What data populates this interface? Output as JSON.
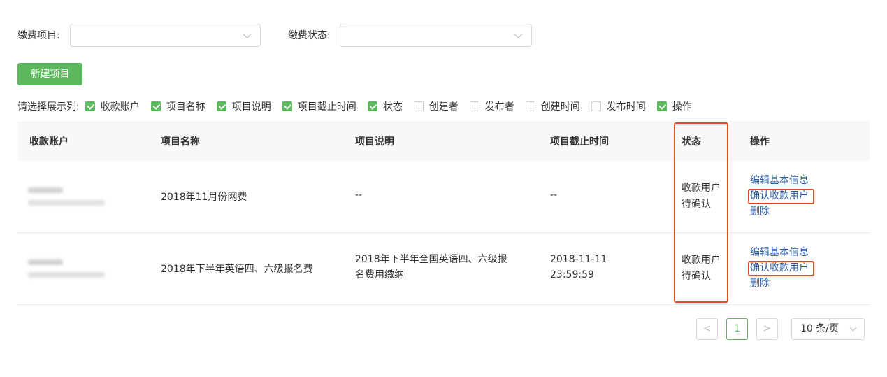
{
  "filters": {
    "item_label": "缴费项目:",
    "item_value": "",
    "status_label": "缴费状态:",
    "status_value": ""
  },
  "new_button": "新建项目",
  "column_chooser": {
    "label": "请选择展示列:",
    "options": [
      {
        "label": "收款账户",
        "checked": true
      },
      {
        "label": "项目名称",
        "checked": true
      },
      {
        "label": "项目说明",
        "checked": true
      },
      {
        "label": "项目截止时间",
        "checked": true
      },
      {
        "label": "状态",
        "checked": true
      },
      {
        "label": "创建者",
        "checked": false
      },
      {
        "label": "发布者",
        "checked": false
      },
      {
        "label": "创建时间",
        "checked": false
      },
      {
        "label": "发布时间",
        "checked": false
      },
      {
        "label": "操作",
        "checked": true
      }
    ]
  },
  "table": {
    "headers": [
      "收款账户",
      "项目名称",
      "项目说明",
      "项目截止时间",
      "状态",
      "操作"
    ],
    "rows": [
      {
        "name": "2018年11月份网费",
        "desc": "--",
        "deadline": "--",
        "deadline_time": "",
        "status": "收款用户",
        "status2": "待确认",
        "actions": [
          "编辑基本信息",
          "确认收款用户",
          "删除"
        ]
      },
      {
        "name": "2018年下半年英语四、六级报名费",
        "desc": "2018年下半年全国英语四、六级报",
        "desc2": "名费用缴纳",
        "deadline": "2018-11-11",
        "deadline_time": "23:59:59",
        "status": "收款用户",
        "status2": "待确认",
        "actions": [
          "编辑基本信息",
          "确认收款用户",
          "删除"
        ]
      }
    ]
  },
  "pagination": {
    "prev": "<",
    "current": "1",
    "next": ">",
    "page_size": "10 条/页"
  },
  "colors": {
    "accent": "#5cb85c",
    "link": "#2d5fa8",
    "highlight": "#e04a1f"
  }
}
